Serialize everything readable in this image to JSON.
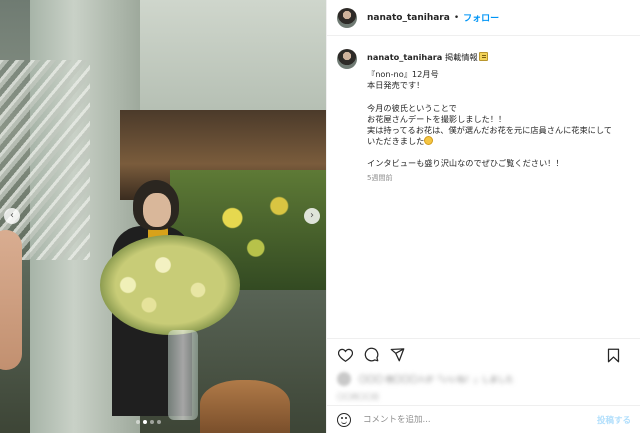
{
  "header": {
    "username": "nanato_tanihara",
    "separator": "•",
    "follow_label": "フォロー"
  },
  "caption": {
    "username": "nanato_tanihara",
    "headline": "掲載情報",
    "line1": "『non-no』12月号",
    "line2": "本日発売です！",
    "line3": "今月の彼氏ということで",
    "line4": "お花屋さんデートを撮影しました！！",
    "line5": "実は持ってるお花は、僕が選んだお花を元に店員さんに花束にして",
    "line6": "いただきました",
    "line7": "インタビューも盛り沢山なのでぜひご覧ください！！",
    "time_ago": "5週間前"
  },
  "likes": {
    "summary_blurred": "〇〇〇 他〇〇〇人が「いいね！」しました",
    "date_blurred": "〇〇月〇〇日"
  },
  "comment": {
    "placeholder": "コメントを追加...",
    "post_label": "投稿する"
  },
  "carousel": {
    "prev_glyph": "‹",
    "next_glyph": "›"
  },
  "colors": {
    "accent": "#0095f6",
    "post_disabled": "#b2dffc",
    "text": "#262626",
    "muted": "#8e8e8e"
  }
}
